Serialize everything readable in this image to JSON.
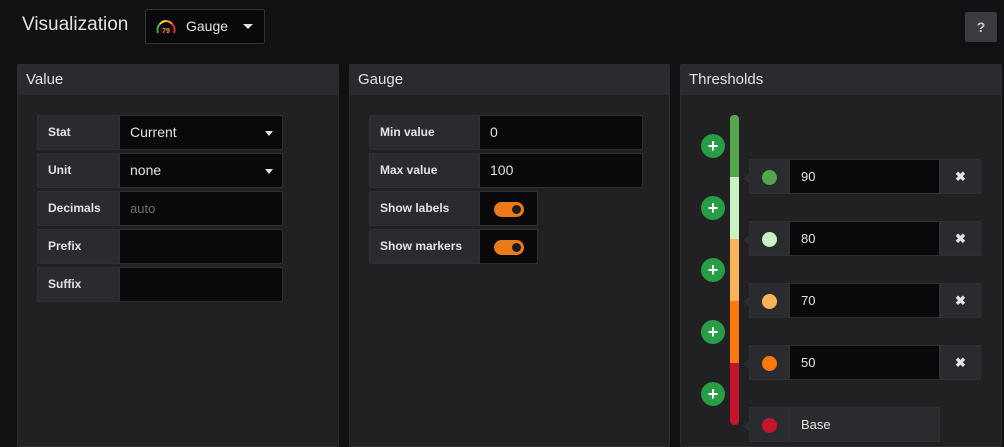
{
  "header": {
    "title": "Visualization",
    "picker_label": "Gauge",
    "picker_icon_value": "79",
    "help_label": "?"
  },
  "value_panel": {
    "title": "Value",
    "rows": [
      {
        "label": "Stat",
        "value": "Current",
        "type": "select"
      },
      {
        "label": "Unit",
        "value": "none",
        "type": "select"
      },
      {
        "label": "Decimals",
        "placeholder": "auto",
        "type": "input"
      },
      {
        "label": "Prefix",
        "value": "",
        "type": "input"
      },
      {
        "label": "Suffix",
        "value": "",
        "type": "input"
      }
    ]
  },
  "gauge_panel": {
    "title": "Gauge",
    "min_label": "Min value",
    "min_value": "0",
    "max_label": "Max value",
    "max_value": "100",
    "show_labels_label": "Show labels",
    "show_labels_on": true,
    "show_markers_label": "Show markers",
    "show_markers_on": true
  },
  "thresholds_panel": {
    "title": "Thresholds",
    "add_icon": "plus-icon",
    "remove_icon": "close-icon",
    "remove_label": "✖",
    "items": [
      {
        "value": "90",
        "color": "#56a64b"
      },
      {
        "value": "80",
        "color": "#c8f2c2"
      },
      {
        "value": "70",
        "color": "#ffb357"
      },
      {
        "value": "50",
        "color": "#ff780a"
      },
      {
        "value": "Base",
        "color": "#c4162a"
      }
    ]
  },
  "colors": {
    "accent_toggle": "#eb7b18",
    "add_button": "#299c46"
  }
}
